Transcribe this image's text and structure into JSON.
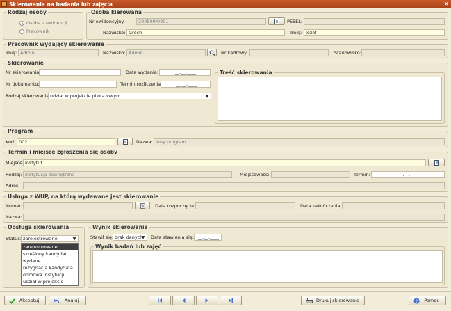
{
  "window": {
    "title": "Skierowania na badania lub zajęcia",
    "close_glyph": "×"
  },
  "osoba": {
    "legend": "Rodzaj osoby",
    "options": [
      "Osoba z ewidencji",
      "Pracownik"
    ],
    "selected": 0
  },
  "kierowana": {
    "legend": "Osoba kierowana",
    "nr_ewid_label": "Nr ewidencyjny:",
    "nr_ewid_value": "200509/0001",
    "pesel_label": "PESEL:",
    "pesel_value": "",
    "nazwisko_label": "Nazwisko:",
    "nazwisko_value": "Groch",
    "imie_label": "Imię:",
    "imie_value": "Józef"
  },
  "pracownik": {
    "legend": "Pracownik wydający skierowanie",
    "imie_label": "Imię:",
    "imie_value": "Admin",
    "nazwisko_label": "Nazwisko:",
    "nazwisko_value": "Admin",
    "nr_kadrowy_label": "Nr kadrowy:",
    "nr_kadrowy_value": "",
    "stanowisko_label": "Stanowisko:",
    "stanowisko_value": ""
  },
  "skierowanie": {
    "legend": "Skierowanie",
    "nr_label": "Nr skierowania:",
    "nr_value": "",
    "data_label": "Data wydania:",
    "data_value": "__.__.____",
    "nr_dok_label": "Nr dokumentu:",
    "nr_dok_value": "",
    "termin_label": "Termin rozliczenia:",
    "termin_value": "__.__.____",
    "rodzaj_label": "Rodzaj skierowania:",
    "rodzaj_value": "udział w projekcie pilotażowym"
  },
  "tresc": {
    "legend": "Treść skierowania",
    "value": ""
  },
  "program": {
    "legend": "Program",
    "kod_label": "Kod:",
    "kod_value": "002",
    "nazwa_label": "Nazwa:",
    "nazwa_value": "inny program"
  },
  "termin_miejsce": {
    "legend": "Termin i miejsce zgłoszenia się osoby",
    "miejsce_label": "Miejsce:",
    "miejsce_value": "instytut",
    "rodzaj_label": "Rodzaj:",
    "rodzaj_value": "instytucja zewnętrzna",
    "miejscowosc_label": "Miejscowość:",
    "miejscowosc_value": "",
    "termin_label": "Termin:",
    "termin_value": "__.__.____",
    "adres_label": "Adres:",
    "adres_value": ""
  },
  "usluga": {
    "legend": "Usługa z WUP, na którą wydawane jest skierowanie",
    "numer_label": "Numer:",
    "numer_value": "",
    "data_rozp_label": "Data rozpoczęcia:",
    "data_rozp_value": "",
    "data_zak_label": "Data zakończenia:",
    "data_zak_value": "",
    "nazwa_label": "Nazwa:",
    "nazwa_value": ""
  },
  "obsluga": {
    "legend": "Obsługa skierowania",
    "status_label": "Status:",
    "status_value": "zarejestrowane",
    "status_options": [
      "zarejestrowane",
      "skreślony kandydat",
      "wydane",
      "rezygnacja kandydata",
      "odmowa instytucji",
      "udział w projekcie"
    ]
  },
  "wynik": {
    "legend": "Wynik skierowania",
    "stawil_label": "Stawił się:",
    "stawil_value": "brak danych",
    "data_label": "Data stawienia się:",
    "data_value": "__.__.____",
    "badan_legend": "Wynik badań lub zajęć",
    "badan_value": ""
  },
  "footer": {
    "akceptuj": "Akceptuj",
    "anuluj": "Anuluj",
    "drukuj": "Drukuj skierowanie",
    "pomoc": "Pomoc"
  },
  "colors": {
    "titlebar": "#b94a1f",
    "panel": "#efe8d3",
    "input_yellow": "#fffde0",
    "accept_green": "#2f9a2f",
    "nav_blue": "#3f6fcf"
  }
}
